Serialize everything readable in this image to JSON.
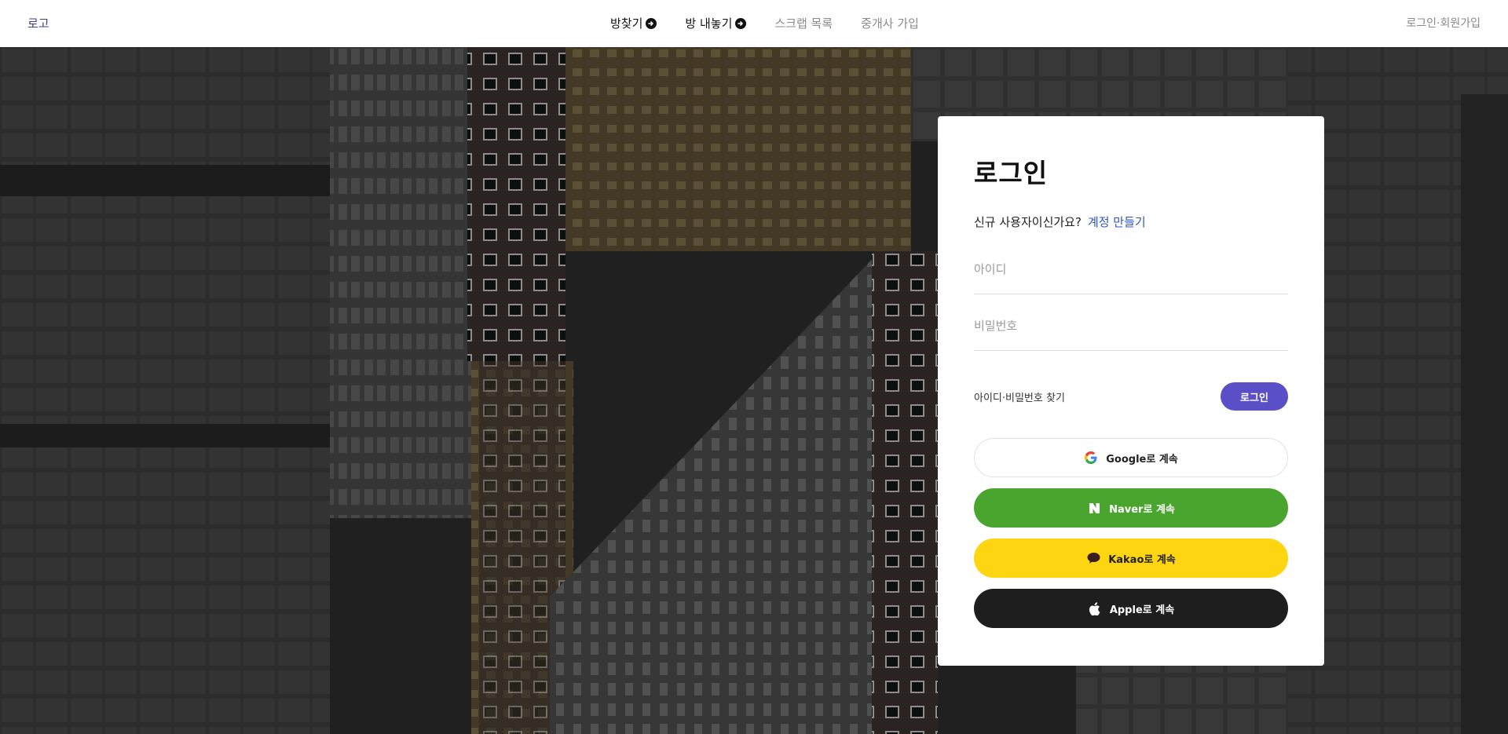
{
  "header": {
    "logo": "로고",
    "nav": [
      {
        "label": "방찾기",
        "icon": "arrow-circle-right-icon"
      },
      {
        "label": "방 내놓기",
        "icon": "arrow-circle-right-icon"
      },
      {
        "label": "스크랩 목록"
      },
      {
        "label": "중개사 가입"
      }
    ],
    "auth_link": "로그인·회원가입"
  },
  "login": {
    "title": "로그인",
    "signup_question": "신규 사용자이신가요?",
    "signup_link": "계정 만들기",
    "id_placeholder": "아이디",
    "password_placeholder": "비밀번호",
    "find_link": "아이디·비밀번호 찾기",
    "login_button": "로그인"
  },
  "social": {
    "google": "Google로 계속",
    "naver": "Naver로 계속",
    "kakao": "Kakao로 계속",
    "apple": "Apple로 계속"
  },
  "colors": {
    "accent": "#5b4fc8",
    "link": "#2b55c9",
    "naver": "#4aa52e",
    "kakao": "#fdd511",
    "apple": "#1e1e1e"
  }
}
